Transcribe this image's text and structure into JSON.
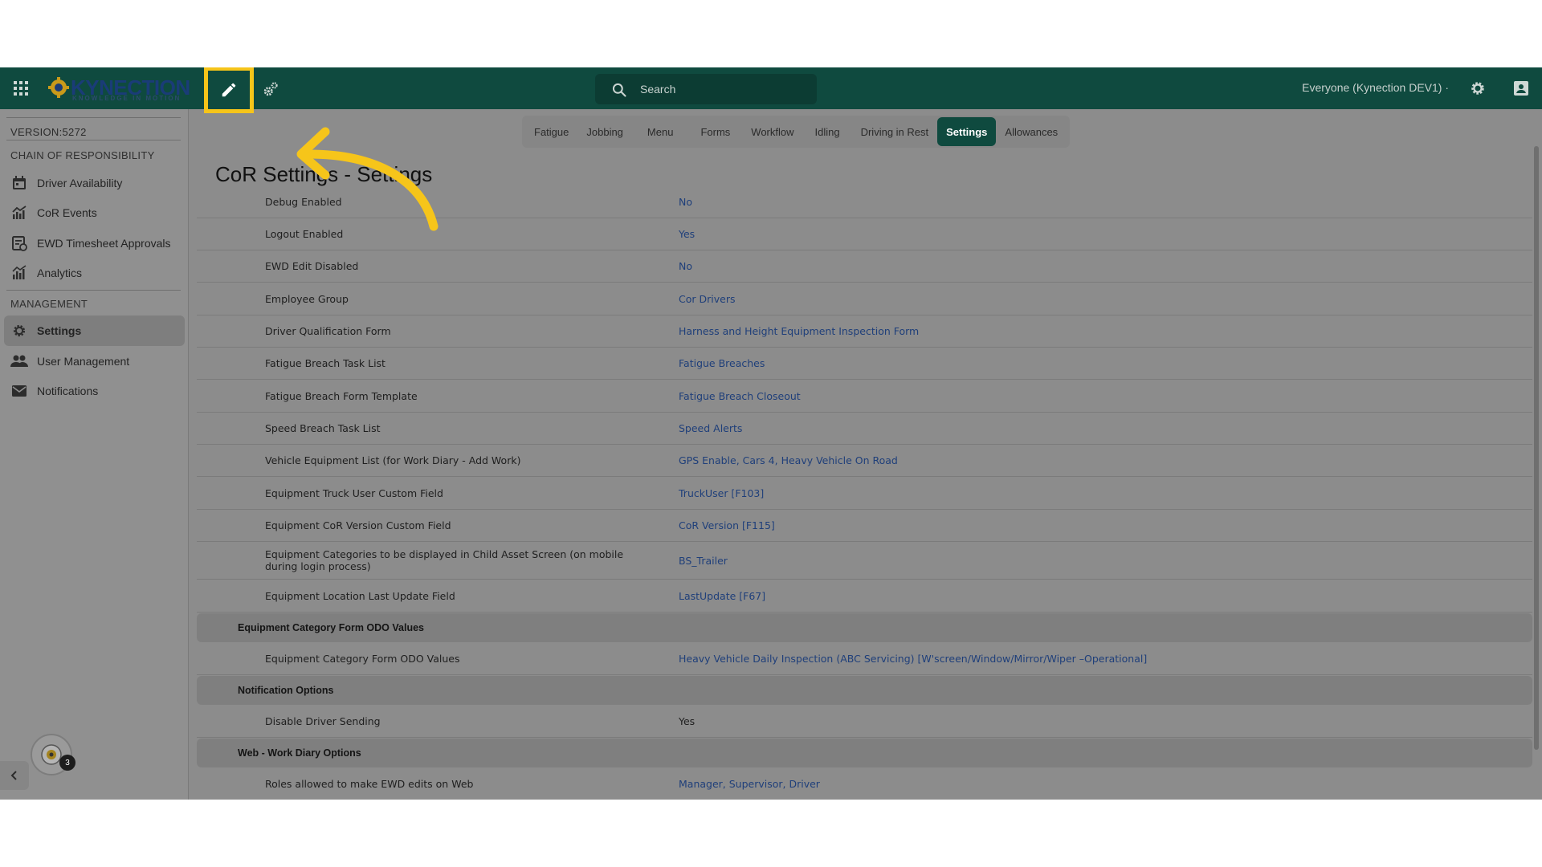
{
  "topbar": {
    "logo_text": "KYNECTION",
    "logo_tagline": "KNOWLEDGE IN MOTION",
    "search_placeholder": "Search",
    "user_select": "Everyone (Kynection DEV1) ·"
  },
  "sidebar": {
    "version": "VERSION:5272",
    "sections": [
      {
        "title": "CHAIN OF RESPONSIBILITY",
        "items": [
          {
            "label": "Driver Availability",
            "icon": "calendar-icon"
          },
          {
            "label": "CoR Events",
            "icon": "chart-icon"
          },
          {
            "label": "EWD Timesheet Approvals",
            "icon": "timesheet-icon"
          },
          {
            "label": "Analytics",
            "icon": "bar-chart-icon"
          }
        ]
      },
      {
        "title": "MANAGEMENT",
        "items": [
          {
            "label": "Settings",
            "icon": "gear-icon",
            "active": true
          },
          {
            "label": "User Management",
            "icon": "users-icon"
          },
          {
            "label": "Notifications",
            "icon": "mail-icon"
          }
        ]
      }
    ],
    "badge_count": "3"
  },
  "tabs": [
    {
      "label": "Fatigue"
    },
    {
      "label": "Jobbing"
    },
    {
      "label": "Menu"
    },
    {
      "label": "Forms"
    },
    {
      "label": "Workflow"
    },
    {
      "label": "Idling"
    },
    {
      "label": "Driving in Rest"
    },
    {
      "label": "Settings",
      "active": true
    },
    {
      "label": "Allowances"
    }
  ],
  "page_title": "CoR Settings - Settings",
  "settings": [
    {
      "key": "Debug Enabled",
      "value": "No"
    },
    {
      "key": "Logout Enabled",
      "value": "Yes"
    },
    {
      "key": "EWD Edit Disabled",
      "value": "No"
    },
    {
      "key": "Employee Group",
      "value": "Cor Drivers"
    },
    {
      "key": "Driver Qualification Form",
      "value": "Harness and Height Equipment Inspection Form"
    },
    {
      "key": "Fatigue Breach Task List",
      "value": "Fatigue Breaches"
    },
    {
      "key": "Fatigue Breach Form Template",
      "value": "Fatigue Breach Closeout"
    },
    {
      "key": "Speed Breach Task List",
      "value": "Speed Alerts"
    },
    {
      "key": "Vehicle Equipment List (for Work Diary - Add Work)",
      "value": "GPS Enable, Cars 4, Heavy Vehicle On Road"
    },
    {
      "key": "Equipment Truck User Custom Field",
      "value": "TruckUser [F103]"
    },
    {
      "key": "Equipment CoR Version Custom Field",
      "value": "CoR Version [F115]"
    },
    {
      "key": "Equipment Categories to be displayed in Child Asset Screen (on mobile during login process)",
      "value": "BS_Trailer"
    },
    {
      "key": "Equipment Location Last Update Field",
      "value": "LastUpdate [F67]"
    }
  ],
  "groups": [
    {
      "title": "Equipment Category Form ODO Values",
      "rows": [
        {
          "key": "Equipment Category Form ODO Values",
          "value": "Heavy Vehicle Daily Inspection (ABC Servicing) [W'screen/Window/Mirror/Wiper –Operational]"
        }
      ]
    },
    {
      "title": "Notification Options",
      "rows": [
        {
          "key": "Disable Driver Sending",
          "value": "Yes",
          "plain": true
        }
      ]
    },
    {
      "title": "Web - Work Diary Options",
      "rows": [
        {
          "key": "Roles allowed to make EWD edits on Web",
          "value": "Manager, Supervisor, Driver"
        }
      ]
    }
  ],
  "colors": {
    "topbar": "#0f4a3f",
    "highlight": "#f6c51a",
    "link": "#1f3f7a"
  }
}
